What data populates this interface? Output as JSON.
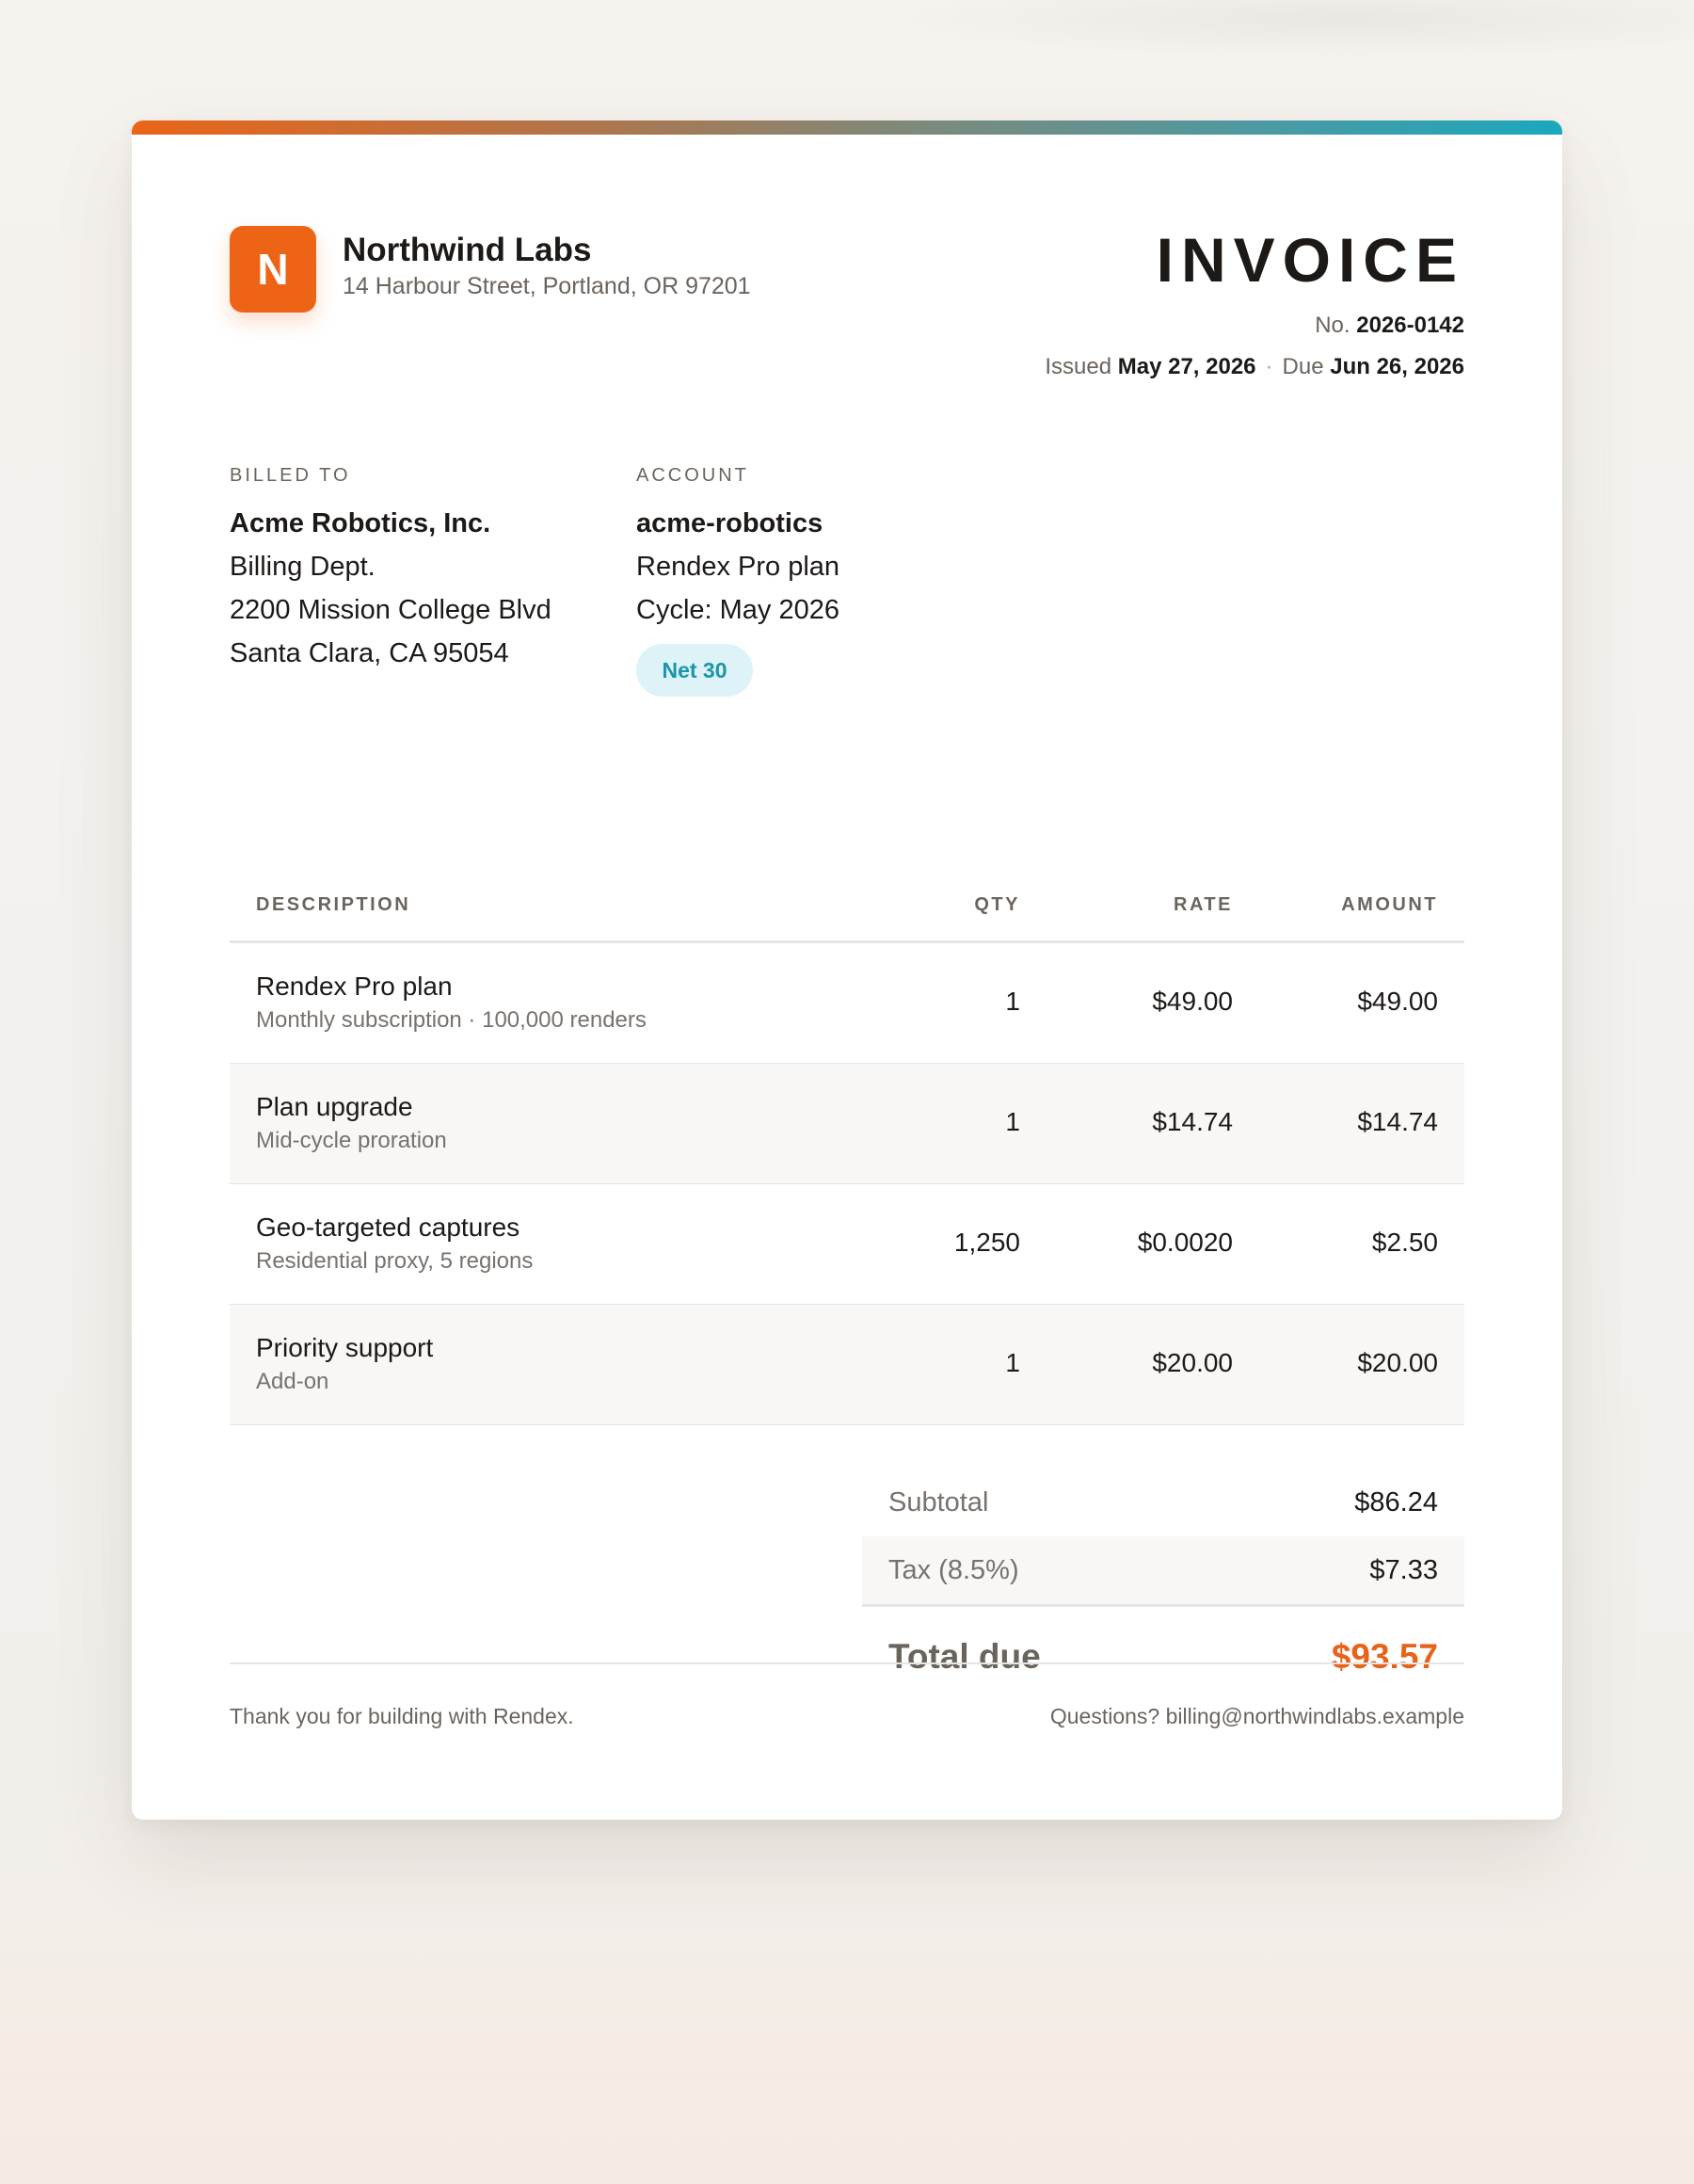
{
  "company": {
    "logo_letter": "N",
    "name": "Northwind Labs",
    "address": "14 Harbour Street, Portland, OR 97201"
  },
  "invoice": {
    "title": "INVOICE",
    "number_label": "No.",
    "number": "2026-0142",
    "issued_label": "Issued",
    "issued": "May 27, 2026",
    "separator": "·",
    "due_label": "Due",
    "due": "Jun 26, 2026"
  },
  "billed_to": {
    "label": "BILLED TO",
    "name": "Acme Robotics, Inc.",
    "dept": "Billing Dept.",
    "street": "2200 Mission College Blvd",
    "city": "Santa Clara, CA 95054"
  },
  "account": {
    "label": "ACCOUNT",
    "id": "acme-robotics",
    "plan": "Rendex Pro plan",
    "cycle": "Cycle: May 2026",
    "terms": "Net 30"
  },
  "table": {
    "headers": {
      "description": "DESCRIPTION",
      "qty": "QTY",
      "rate": "RATE",
      "amount": "AMOUNT"
    },
    "rows": [
      {
        "title": "Rendex Pro plan",
        "subtitle": "Monthly subscription · 100,000 renders",
        "qty": "1",
        "rate": "$49.00",
        "amount": "$49.00"
      },
      {
        "title": "Plan upgrade",
        "subtitle": "Mid-cycle proration",
        "qty": "1",
        "rate": "$14.74",
        "amount": "$14.74"
      },
      {
        "title": "Geo-targeted captures",
        "subtitle": "Residential proxy, 5 regions",
        "qty": "1,250",
        "rate": "$0.0020",
        "amount": "$2.50"
      },
      {
        "title": "Priority support",
        "subtitle": "Add-on",
        "qty": "1",
        "rate": "$20.00",
        "amount": "$20.00"
      }
    ]
  },
  "totals": {
    "subtotal_label": "Subtotal",
    "subtotal": "$86.24",
    "tax_label": "Tax (8.5%)",
    "tax": "$7.33",
    "total_label": "Total due",
    "total": "$93.57"
  },
  "footer": {
    "thanks": "Thank you for building with Rendex.",
    "contact": "Questions? billing@northwindlabs.example"
  },
  "colors": {
    "brand": "#ee6416",
    "accent_teal": "#1aa8bd",
    "total": "#e8631a",
    "badge_bg": "#ddf3f8",
    "badge_text": "#1b95a8"
  }
}
